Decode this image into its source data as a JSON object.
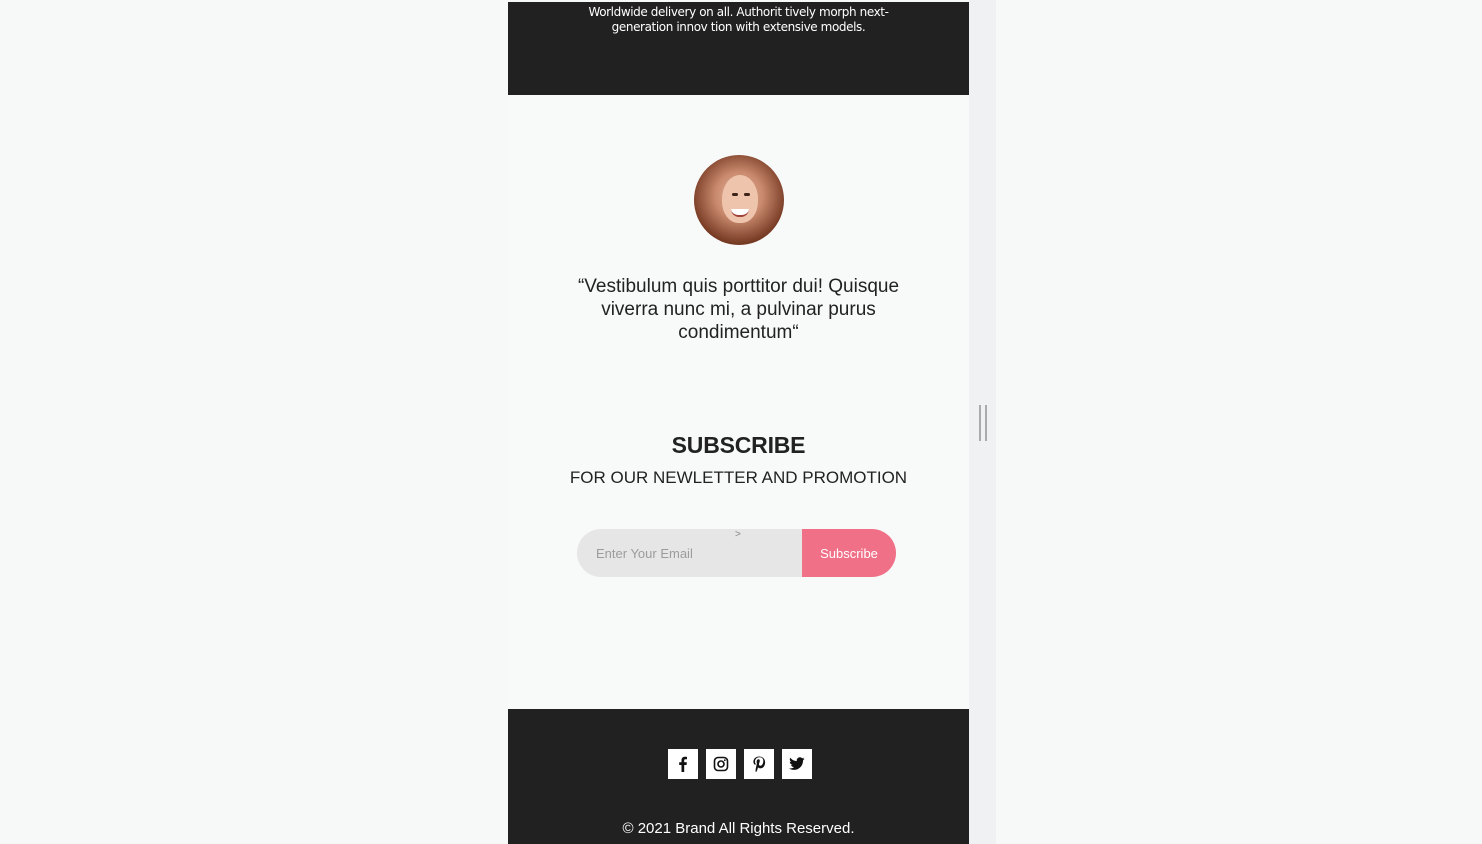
{
  "top_band": {
    "text": "Worldwide delivery on all. Authorit tively morph next-generation innov tion with extensive models."
  },
  "testimonial": {
    "quote": "“Vestibulum quis porttitor dui! Quisque viverra nunc mi, a pulvinar purus condimentum“"
  },
  "subscribe": {
    "title": "SUBSCRIBE",
    "caption": "FOR OUR NEWLETTER AND PROMOTION",
    "email_placeholder": "Enter Your Email",
    "caret": ">",
    "button_label": "Subscribe"
  },
  "footer": {
    "socials": [
      "facebook-icon",
      "instagram-icon",
      "pinterest-icon",
      "twitter-icon"
    ],
    "copyright": "© 2021 Brand All Rights Reserved."
  },
  "colors": {
    "dark": "#212121",
    "accent": "#f07088",
    "page_bg": "#f8f9f9"
  }
}
